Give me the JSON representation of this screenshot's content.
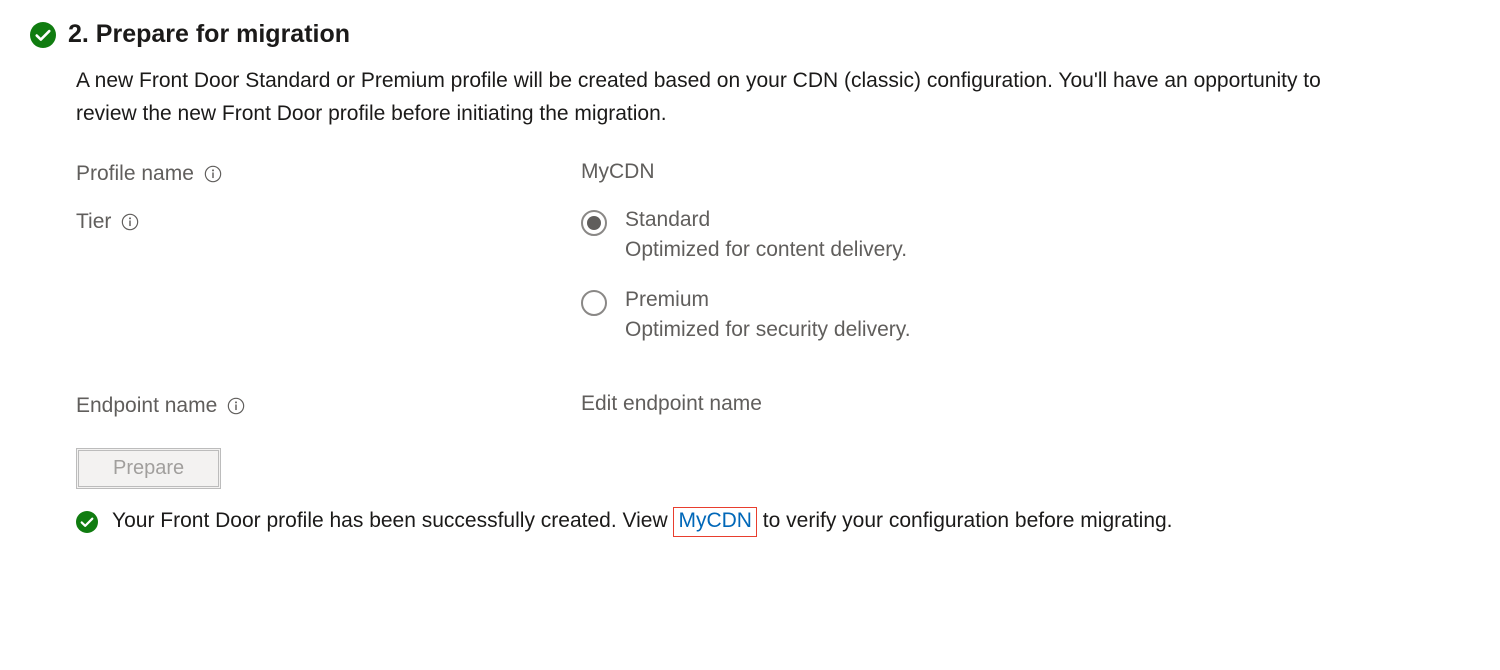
{
  "heading": "2. Prepare for migration",
  "description": "A new Front Door Standard or Premium profile will be created based on your CDN (classic) configuration. You'll have an opportunity to review the new Front Door profile before initiating the migration.",
  "fields": {
    "profile_name": {
      "label": "Profile name",
      "value": "MyCDN"
    },
    "tier": {
      "label": "Tier",
      "options": {
        "standard": {
          "title": "Standard",
          "sub": "Optimized for content delivery."
        },
        "premium": {
          "title": "Premium",
          "sub": "Optimized for security delivery."
        }
      }
    },
    "endpoint_name": {
      "label": "Endpoint name",
      "value": "Edit endpoint name"
    }
  },
  "buttons": {
    "prepare": "Prepare"
  },
  "status": {
    "pre": "Your Front Door profile has been successfully created. View ",
    "link": "MyCDN",
    "post": " to verify your configuration before migrating."
  }
}
